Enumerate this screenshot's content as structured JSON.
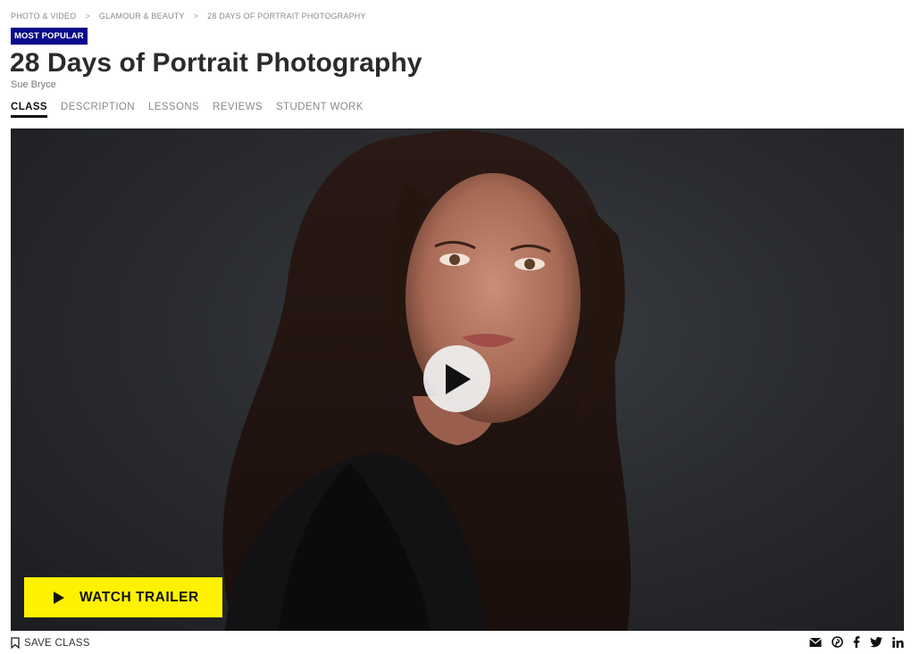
{
  "breadcrumb": {
    "items": [
      "PHOTO & VIDEO",
      "GLAMOUR & BEAUTY",
      "28 DAYS OF PORTRAIT PHOTOGRAPHY"
    ],
    "separator": ">"
  },
  "badge": {
    "label": "MOST POPULAR",
    "color": "#0a0a8c"
  },
  "course": {
    "title": "28 Days of Portrait Photography",
    "instructor": "Sue Bryce"
  },
  "tabs": [
    {
      "label": "CLASS",
      "active": true
    },
    {
      "label": "DESCRIPTION",
      "active": false
    },
    {
      "label": "LESSONS",
      "active": false
    },
    {
      "label": "REVIEWS",
      "active": false
    },
    {
      "label": "STUDENT WORK",
      "active": false
    }
  ],
  "video": {
    "play_icon": "play-icon",
    "trailer_label": "WATCH TRAILER",
    "trailer_color": "#fff200"
  },
  "footer": {
    "save_label": "SAVE CLASS",
    "save_icon": "bookmark-icon",
    "share_icons": [
      "email-icon",
      "pinterest-icon",
      "facebook-icon",
      "twitter-icon",
      "linkedin-icon"
    ]
  }
}
